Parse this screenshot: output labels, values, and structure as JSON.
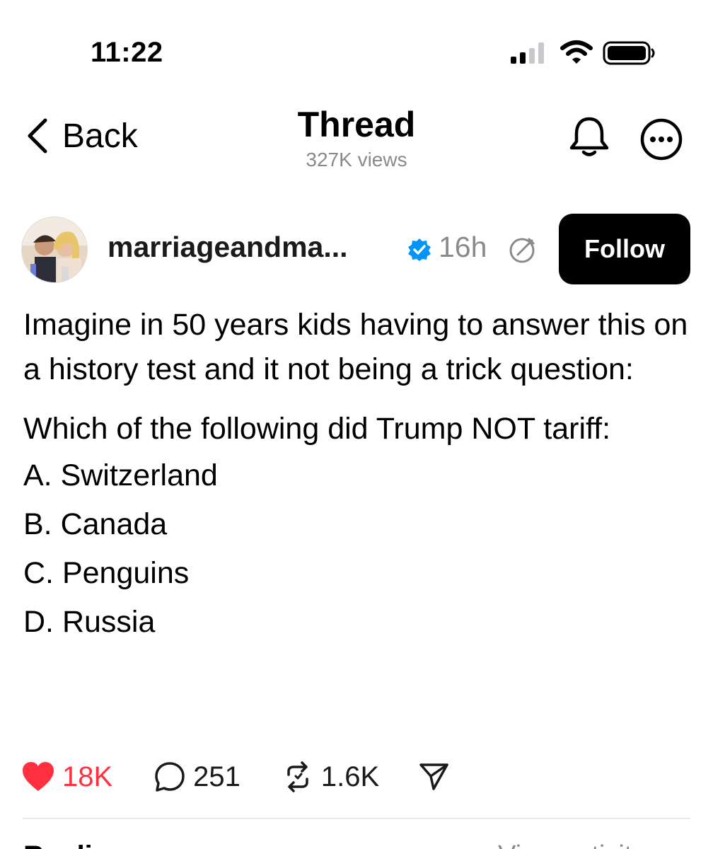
{
  "status_bar": {
    "time": "11:22",
    "icons": [
      "cellular-signal-icon",
      "wifi-icon",
      "battery-icon"
    ]
  },
  "header": {
    "back_label": "Back",
    "title": "Thread",
    "subtitle": "327K views",
    "icons": [
      "chevron-left-icon",
      "bell-icon",
      "more-icon"
    ]
  },
  "post": {
    "username": "marriageandma...",
    "verified": true,
    "time_ago": "16h",
    "follow_label": "Follow",
    "text": "Imagine in 50 years kids having to answer this on a history test and it not being a trick question:",
    "question": "Which of the following did Trump NOT tariff:",
    "options": [
      "A. Switzerland",
      "B. Canada",
      "C. Penguins",
      "D. Russia"
    ],
    "likes": "18K",
    "replies": "251",
    "reposts": "1.6K",
    "liked": true
  },
  "footer": {
    "replies_label": "Replies",
    "view_activity_label": "View activity"
  },
  "colors": {
    "like": "#ff3040",
    "verified": "#0095f6",
    "secondary_text": "#8a8a8e",
    "follow_bg": "#000000"
  }
}
